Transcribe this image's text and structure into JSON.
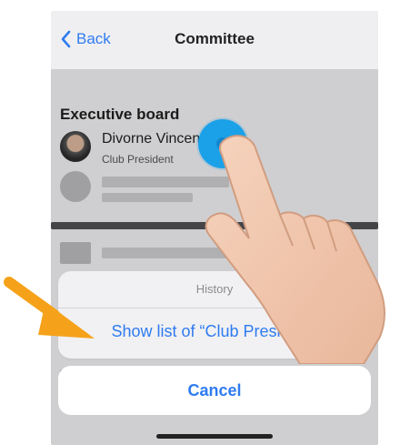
{
  "navbar": {
    "back_label": "Back",
    "title": "Committee"
  },
  "section": {
    "title": "Executive board"
  },
  "member": {
    "name": "Divorne Vincent",
    "role": "Club President"
  },
  "action_sheet": {
    "title": "History",
    "action": "Show list of “Club President”"
  },
  "cancel_label": "Cancel",
  "colors": {
    "accent": "#2f7bf0",
    "tap_indicator": "#1ba1e8",
    "annotation_arrow": "#f5a21a"
  },
  "icons": {
    "back": "chevron-left-icon"
  }
}
